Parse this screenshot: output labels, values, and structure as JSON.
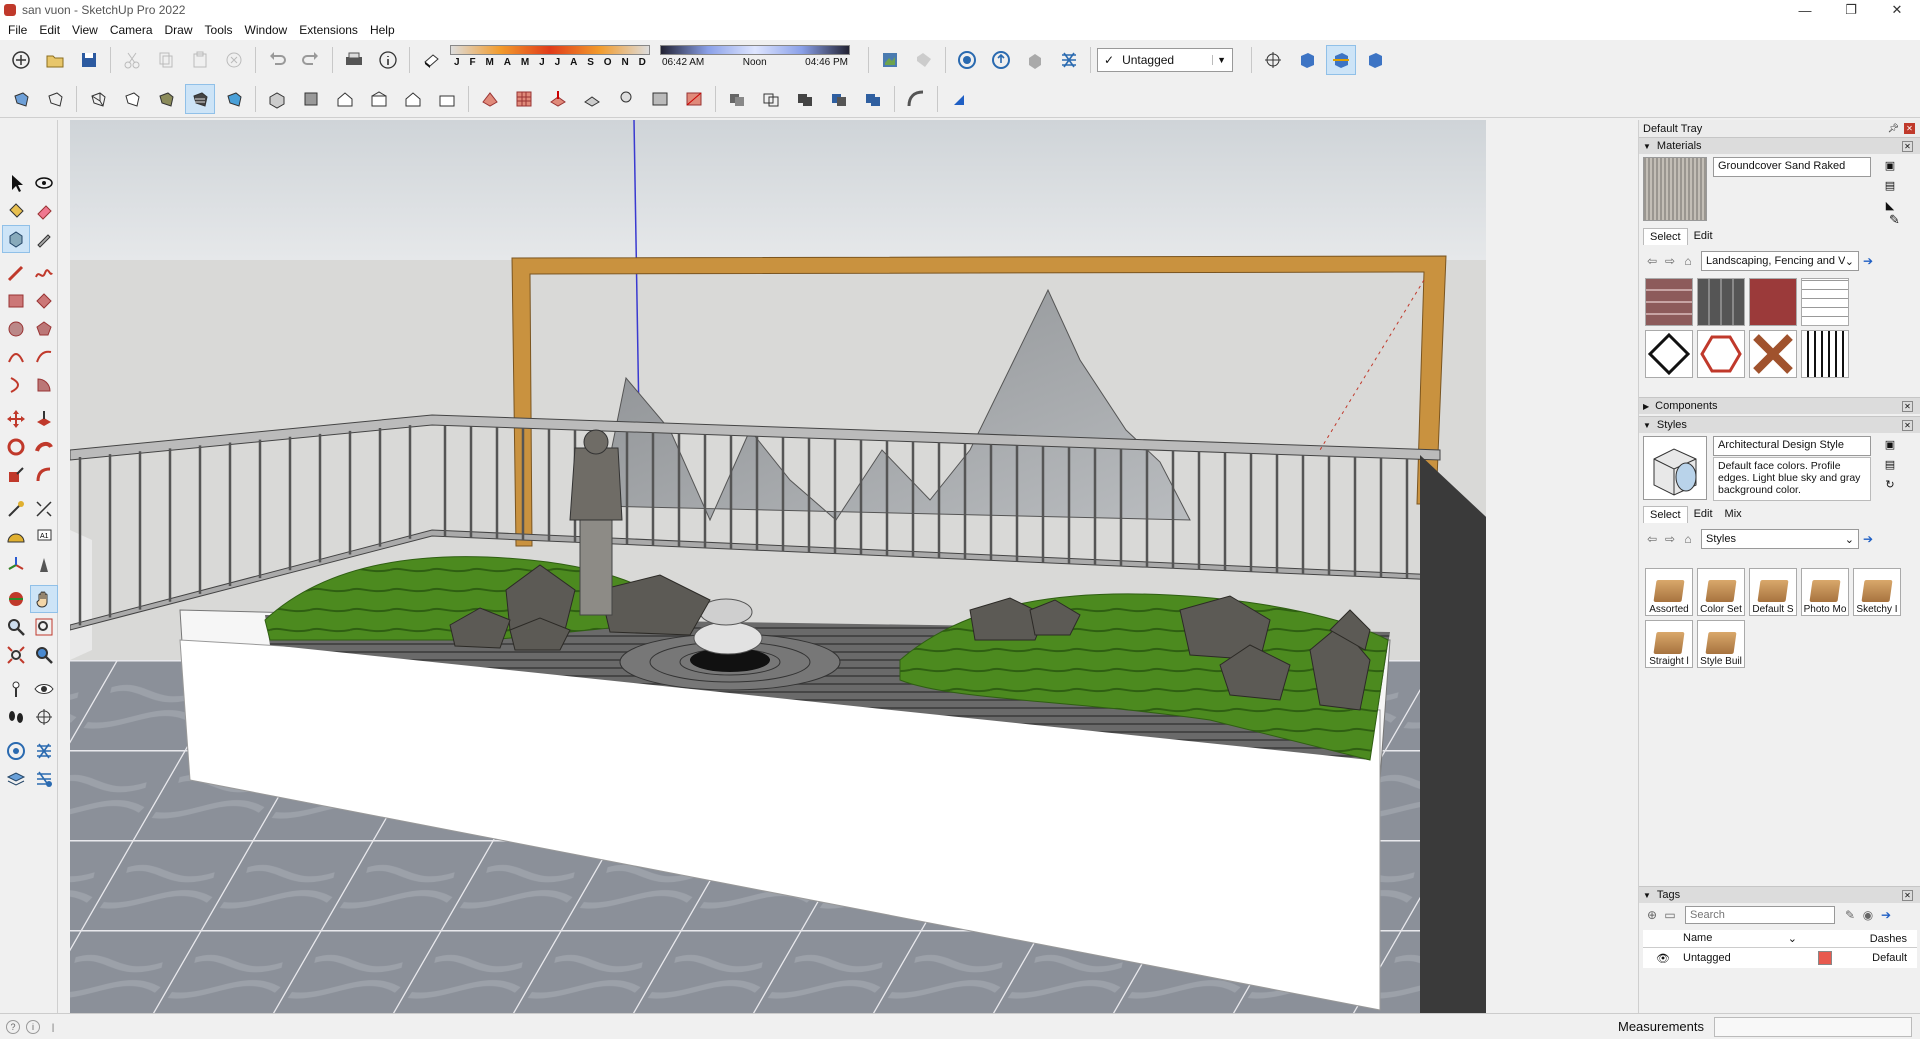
{
  "window": {
    "title": "san vuon - SketchUp Pro 2022",
    "controls": [
      "—",
      "❐",
      "✕"
    ]
  },
  "menu": [
    "File",
    "Edit",
    "View",
    "Camera",
    "Draw",
    "Tools",
    "Window",
    "Extensions",
    "Help"
  ],
  "shadow": {
    "months": [
      "J",
      "F",
      "M",
      "A",
      "M",
      "J",
      "J",
      "A",
      "S",
      "O",
      "N",
      "D"
    ],
    "time_start": "06:42 AM",
    "time_mid": "Noon",
    "time_end": "04:46 PM"
  },
  "tag_dropdown": {
    "check": "✓",
    "value": "Untagged"
  },
  "tray": {
    "title": "Default Tray",
    "materials": {
      "header": "Materials",
      "current": "Groundcover Sand Raked",
      "tabs": [
        "Select",
        "Edit"
      ],
      "library": "Landscaping, Fencing and Ve"
    },
    "components": {
      "header": "Components"
    },
    "styles": {
      "header": "Styles",
      "current": "Architectural Design Style",
      "description": "Default face colors. Profile edges. Light blue sky and gray background color.",
      "tabs": [
        "Select",
        "Edit",
        "Mix"
      ],
      "library": "Styles",
      "items": [
        "Assorted",
        "Color Set",
        "Default S",
        "Photo Mo",
        "Sketchy I",
        "Straight l",
        "Style Buil"
      ]
    },
    "tags": {
      "header": "Tags",
      "search_placeholder": "Search",
      "col_name": "Name",
      "col_dashes": "Dashes",
      "rows": [
        {
          "name": "Untagged",
          "dashes": "Default",
          "color": "#e85a4f"
        }
      ]
    }
  },
  "status": {
    "measurements_label": "Measurements"
  },
  "colors": {
    "chrome": "#f0f0f0",
    "selection": "#cde4f7",
    "sky": "#dfe3e6",
    "ground": "#d9d9d7",
    "grass": "#4c8a1f",
    "frame": "#c9923f"
  }
}
